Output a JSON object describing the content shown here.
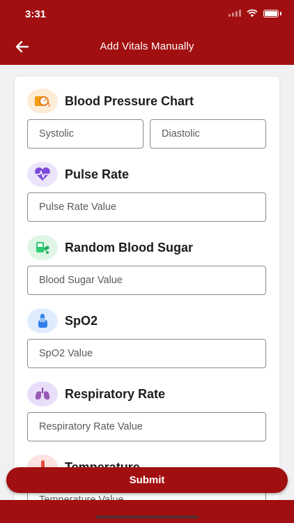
{
  "status_bar": {
    "time": "3:31"
  },
  "app_bar": {
    "title": "Add Vitals Manually",
    "back_icon": "arrow-left-icon"
  },
  "sections": {
    "blood_pressure": {
      "title": "Blood Pressure Chart",
      "icon": "blood-pressure-monitor-icon",
      "systolic_placeholder": "Systolic",
      "diastolic_placeholder": "Diastolic"
    },
    "pulse_rate": {
      "title": "Pulse Rate",
      "icon": "heart-pulse-icon",
      "placeholder": "Pulse Rate Value"
    },
    "blood_sugar": {
      "title": "Random Blood Sugar",
      "icon": "glucometer-icon",
      "placeholder": "Blood Sugar Value"
    },
    "spo2": {
      "title": "SpO2",
      "icon": "finger-oximeter-icon",
      "placeholder": "SpO2 Value"
    },
    "respiratory_rate": {
      "title": "Respiratory Rate",
      "icon": "lungs-icon",
      "placeholder": "Respiratory Rate Value"
    },
    "temperature": {
      "title": "Temperature",
      "icon": "thermometer-icon",
      "placeholder": "Temperature Value"
    }
  },
  "submit_label": "Submit",
  "colors": {
    "primary": "#a10f10",
    "bp_icon_bg": "#fdecd6",
    "pulse_icon_bg": "#ebe4fb",
    "sugar_icon_bg": "#dff5e6",
    "spo2_icon_bg": "#dfecfd",
    "resp_icon_bg": "#e8defa",
    "temp_icon_bg": "#fde2e2"
  }
}
